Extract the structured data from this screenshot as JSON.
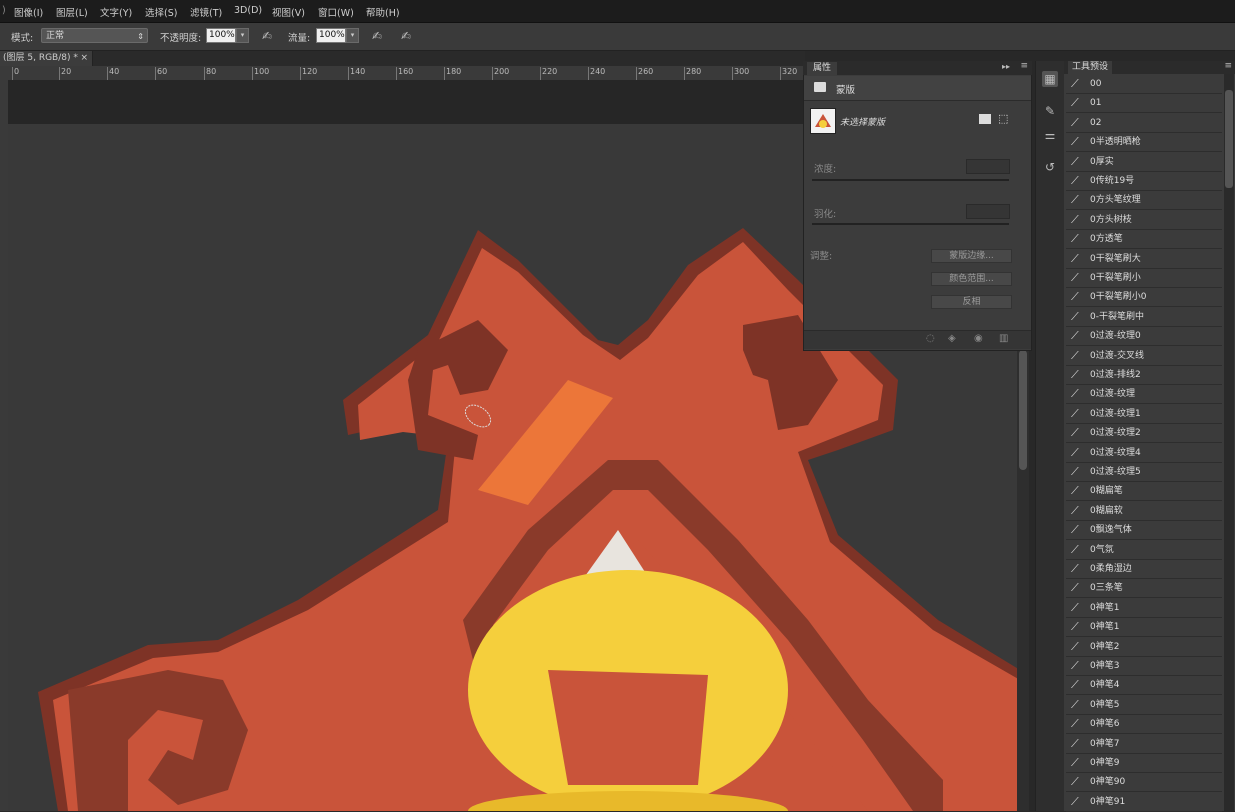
{
  "menu": [
    "图像(I)",
    "图层(L)",
    "文字(Y)",
    "选择(S)",
    "滤镜(T)",
    "3D(D)",
    "视图(V)",
    "窗口(W)",
    "帮助(H)"
  ],
  "options": {
    "mode_label": "模式:",
    "mode_value": "正常",
    "opacity_label": "不透明度:",
    "opacity_value": "100%",
    "flow_label": "流量:",
    "flow_value": "100%"
  },
  "document": {
    "tab_label": "(图层 5, RGB/8) *",
    "close": "×"
  },
  "ruler_marks": [
    "0",
    "20",
    "40",
    "60",
    "80",
    "100",
    "120",
    "140",
    "160",
    "180",
    "200",
    "220",
    "240",
    "260",
    "280",
    "300",
    "320"
  ],
  "properties": {
    "tab": "属性",
    "section_title": "蒙版",
    "mask_name": "未选择蒙版",
    "density_label": "浓度:",
    "feather_label": "羽化:",
    "adjust_label": "调整:",
    "btn_mask_edge": "蒙版边缘...",
    "btn_color_range": "颜色范围...",
    "btn_invert": "反相"
  },
  "presets": {
    "tab": "工具预设",
    "items": [
      "00",
      "01",
      "02",
      "0半透明晒枪",
      "0厚实",
      "0传统19号",
      "0方头笔纹理",
      "0方头树枝",
      "0方透笔",
      "0干裂笔刷大",
      "0干裂笔刷小",
      "0干裂笔刷小0",
      "0-干裂笔刷中",
      "0过渡-纹理0",
      "0过渡-交叉线",
      "0过渡-排线2",
      "0过渡-纹理",
      "0过渡-纹理1",
      "0过渡-纹理2",
      "0过渡-纹理4",
      "0过渡-纹理5",
      "0糊扁笔",
      "0糊扁软",
      "0飘逸气体",
      "0气氛",
      "0柔角湿边",
      "0三条笔",
      "0神笔1",
      "0神笔1",
      "0神笔2",
      "0神笔3",
      "0神笔4",
      "0神笔5",
      "0神笔6",
      "0神笔7",
      "0神笔9",
      "0神笔90",
      "0神笔91"
    ]
  },
  "colors": {
    "ornament_red": "#c9543a",
    "ornament_dark": "#7e3326",
    "highlight_orange": "#f07a3a",
    "coin_yellow": "#f5cf3c",
    "canvas_bg": "#393939"
  }
}
